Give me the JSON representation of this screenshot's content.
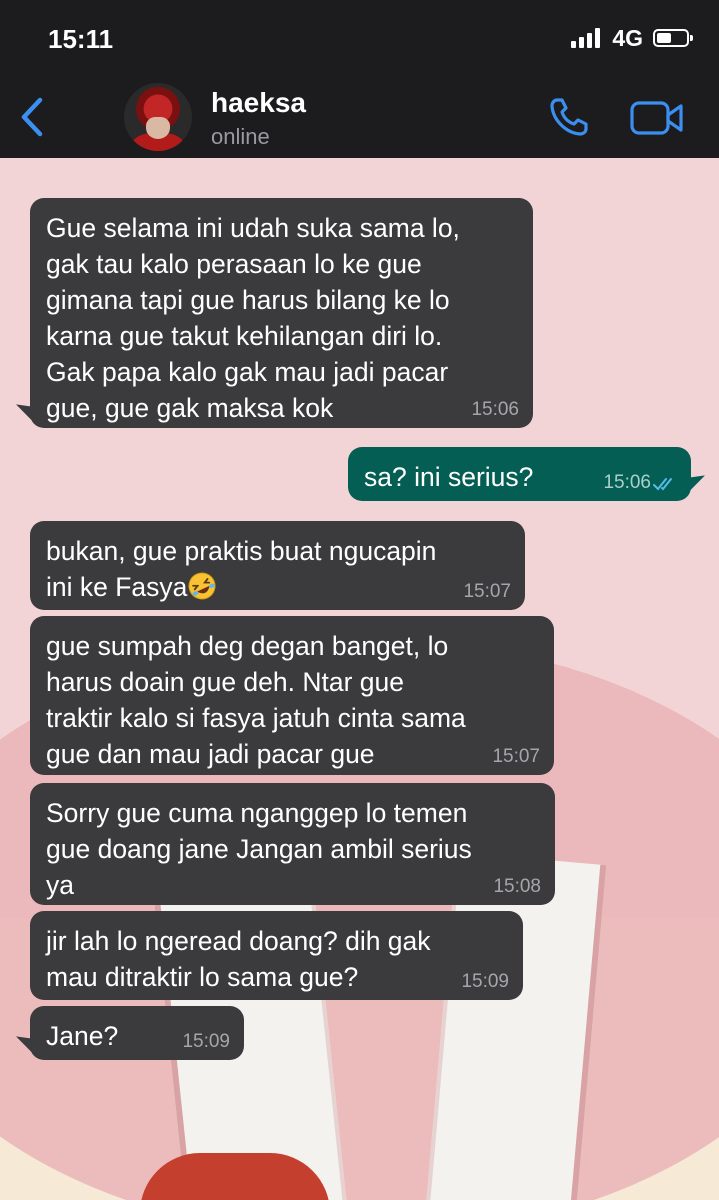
{
  "status_bar": {
    "time": "15:11",
    "network": "4G"
  },
  "header": {
    "contact_name": "haeksa",
    "contact_status": "online"
  },
  "colors": {
    "accent": "#3b8ff0",
    "incoming_bubble": "#3b3b3d",
    "outgoing_bubble": "#055e54",
    "read_ticks": "#53bdeb"
  },
  "icons": {
    "back": "chevron-left-icon",
    "call": "phone-icon",
    "video": "video-camera-icon",
    "read_receipt": "double-check-icon",
    "emoji": "rolling-on-floor-laughing-emoji"
  },
  "messages": [
    {
      "direction": "incoming",
      "text": "Gue selama ini udah suka sama lo,\ngak tau kalo perasaan lo ke gue\ngimana tapi gue harus bilang ke lo\nkarna gue takut kehilangan diri lo.\nGak papa kalo gak mau jadi pacar\ngue, gue gak maksa kok",
      "time": "15:06"
    },
    {
      "direction": "outgoing",
      "text": "sa? ini serius?",
      "time": "15:06",
      "status": "read"
    },
    {
      "direction": "incoming",
      "text": "bukan, gue praktis buat ngucapin\nini ke Fasya",
      "time": "15:07",
      "emoji": "🤣"
    },
    {
      "direction": "incoming",
      "text": "gue sumpah deg degan banget, lo\nharus doain gue deh. Ntar gue\ntraktir kalo si fasya jatuh cinta sama\ngue dan mau jadi pacar gue",
      "time": "15:07"
    },
    {
      "direction": "incoming",
      "text": "Sorry gue cuma nganggep lo temen\ngue doang jane Jangan ambil serius\nya",
      "time": "15:08"
    },
    {
      "direction": "incoming",
      "text": "jir lah lo ngeread doang? dih gak\nmau ditraktir lo sama gue?",
      "time": "15:09"
    },
    {
      "direction": "incoming",
      "text": "Jane?",
      "time": "15:09"
    }
  ]
}
